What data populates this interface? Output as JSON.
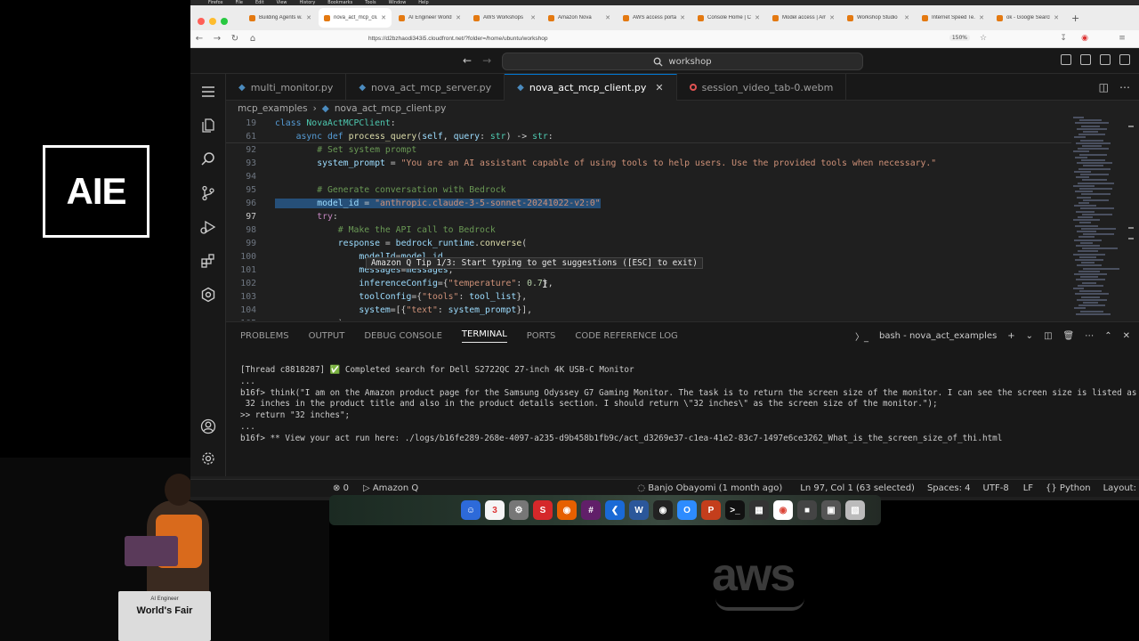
{
  "branding": {
    "logo_text": "AIE",
    "lectern_small": "AI Engineer",
    "lectern_text": "World's Fair",
    "aws_text": "aws"
  },
  "menubar": {
    "items": [
      "Firefox",
      "File",
      "Edit",
      "View",
      "History",
      "Bookmarks",
      "Tools",
      "Window",
      "Help"
    ]
  },
  "browser": {
    "tabs": [
      {
        "label": "Building Agents w..."
      },
      {
        "label": "nova_act_mcp_cli...",
        "active": true
      },
      {
        "label": "AI Engineer World's..."
      },
      {
        "label": "AWS Workshops"
      },
      {
        "label": "Amazon Nova"
      },
      {
        "label": "AWS access portal"
      },
      {
        "label": "Console Home | Co..."
      },
      {
        "label": "Model access | Am..."
      },
      {
        "label": "Workshop Studio"
      },
      {
        "label": "Internet Speed Te..."
      },
      {
        "label": "ok - Google Search"
      }
    ],
    "url": "https://d2bzhaodi343i5.cloudfront.net/?folder=/home/ubuntu/workshop",
    "zoom": "150%"
  },
  "vscode": {
    "command_center": "workshop",
    "tabs": [
      {
        "label": "multi_monitor.py"
      },
      {
        "label": "nova_act_mcp_server.py"
      },
      {
        "label": "nova_act_mcp_client.py",
        "active": true
      },
      {
        "label": "session_video_tab-0.webm"
      }
    ],
    "breadcrumb": {
      "folder": "mcp_examples",
      "file": "nova_act_mcp_client.py"
    },
    "code_lines": [
      {
        "num": "19",
        "html": "<span class=\"kw\">class</span> <span class=\"cls\">NovaActMCPClient</span>:"
      },
      {
        "num": "61",
        "html": "    <span class=\"kw\">async</span> <span class=\"kw\">def</span> <span class=\"fn\">process_query</span>(<span class=\"var\">self</span>, <span class=\"var\">query</span>: <span class=\"cls\">str</span>) -> <span class=\"cls\">str</span>:"
      },
      {
        "num": "92",
        "html": "        <span class=\"cm\"># Set system prompt</span>"
      },
      {
        "num": "93",
        "html": "        <span class=\"var\">system_prompt</span> = <span class=\"str\">\"You are an AI assistant capable of using tools to help users. Use the provided tools when necessary.\"</span>"
      },
      {
        "num": "94",
        "html": ""
      },
      {
        "num": "95",
        "html": "        <span class=\"cm\"># Generate conversation with Bedrock</span>"
      },
      {
        "num": "96",
        "html": "<span class=\"sel\">        <span class=\"var\">model_id</span> = <span class=\"str\">\"anthropic.claude-3-5-sonnet-20241022-v2:0\"</span></span>"
      },
      {
        "num": "97",
        "html": "        <span class=\"ctl\">try</span>:"
      },
      {
        "num": "98",
        "html": "            <span class=\"cm\"># Make the API call to Bedrock</span>"
      },
      {
        "num": "99",
        "html": "            <span class=\"var\">response</span> = <span class=\"var\">bedrock_runtime</span>.<span class=\"fn\">converse</span>("
      },
      {
        "num": "100",
        "html": "                <span class=\"var\">modelId</span>=<span class=\"var\">model_id</span>,"
      },
      {
        "num": "101",
        "html": "                <span class=\"var\">messages</span>=<span class=\"var\">messages</span>,"
      },
      {
        "num": "102",
        "html": "                <span class=\"var\">inferenceConfig</span>={<span class=\"str\">\"temperature\"</span>: <span class=\"num\">0.7</span>},"
      },
      {
        "num": "103",
        "html": "                <span class=\"var\">toolConfig</span>={<span class=\"str\">\"tools\"</span>: <span class=\"var\">tool_list</span>},"
      },
      {
        "num": "104",
        "html": "                <span class=\"var\">system</span>=[{<span class=\"str\">\"text\"</span>: <span class=\"var\">system_prompt</span>}],"
      },
      {
        "num": "105",
        "html": "            )"
      }
    ],
    "tip": "Amazon Q Tip 1/3: Start typing to get suggestions ([ESC] to exit)",
    "panel": {
      "tabs": [
        "PROBLEMS",
        "OUTPUT",
        "DEBUG CONSOLE",
        "TERMINAL",
        "PORTS",
        "CODE REFERENCE LOG"
      ],
      "active_tab": "TERMINAL",
      "terminal_name": "bash - nova_act_examples",
      "lines": [
        "[Thread c8818287] ✅ Completed search for Dell S2722QC 27-inch 4K USB-C Monitor",
        "...",
        "b16f> think(\"I am on the Amazon product page for the Samsung Odyssey G7 Gaming Monitor. The task is to return the screen size of the monitor. I can see the screen size is listed as",
        " 32 inches in the product title and also in the product details section. I should return \\\"32 inches\\\" as the screen size of the monitor.\");",
        ">> return \"32 inches\";",
        "...",
        "b16f> ** View your act run here: ./logs/b16fe289-268e-4097-a235-d9b458b1fb9c/act_d3269e37-c1ea-41e2-83c7-1497e6ce3262_What_is_the_screen_size_of_thi.html"
      ]
    },
    "status": {
      "errors": "0",
      "amazon_q": "Amazon Q",
      "blame": "Banjo Obayomi (1 month ago)",
      "position": "Ln 97, Col 1 (63 selected)",
      "spaces": "Spaces: 4",
      "encoding": "UTF-8",
      "eol": "LF",
      "language": "Python",
      "layout": "Layout: U.S."
    }
  },
  "colors": {
    "accent": "#0078d4",
    "editor_bg": "#1f1f1f",
    "selection": "#264f78"
  }
}
